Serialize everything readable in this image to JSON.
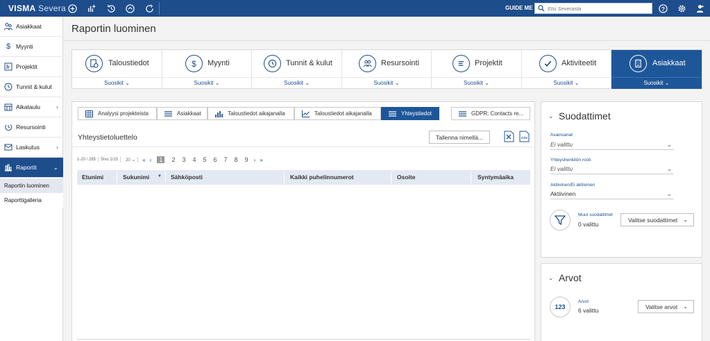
{
  "topbar": {
    "brand_bold": "VISMA",
    "brand_light": "Severa",
    "guide_label": "GUIDE ME",
    "search_placeholder": "Etsi Severasta"
  },
  "sidebar": {
    "items": [
      {
        "label": "Asiakkaat",
        "icon": "customers-icon"
      },
      {
        "label": "Myynti",
        "icon": "dollar-icon"
      },
      {
        "label": "Projektit",
        "icon": "project-icon"
      },
      {
        "label": "Tunnit & kulut",
        "icon": "clock-icon"
      },
      {
        "label": "Aikataulu",
        "icon": "calendar-icon"
      },
      {
        "label": "Resursointi",
        "icon": "resource-icon"
      },
      {
        "label": "Laskutus",
        "icon": "invoice-icon"
      },
      {
        "label": "Raportit",
        "icon": "reports-icon"
      }
    ],
    "sub_items": [
      {
        "label": "Raportin luominen"
      },
      {
        "label": "Raporttigalleria"
      }
    ]
  },
  "page": {
    "title": "Raportin luominen"
  },
  "cards": [
    {
      "label": "Taloustiedot",
      "favorites": "Suosikit"
    },
    {
      "label": "Myynti",
      "favorites": "Suosikit"
    },
    {
      "label": "Tunnit & kulut",
      "favorites": "Suosikit"
    },
    {
      "label": "Resursointi",
      "favorites": "Suosikit"
    },
    {
      "label": "Projektit",
      "favorites": "Suosikit"
    },
    {
      "label": "Aktiviteetit",
      "favorites": "Suosikit"
    },
    {
      "label": "Asiakkaat",
      "favorites": "Suosikit"
    }
  ],
  "tabs": [
    {
      "label": "Analyysi projekteista"
    },
    {
      "label": "Asiakkaat"
    },
    {
      "label": "Taloustiedot aikajanalla"
    },
    {
      "label": "Taloustiedot aikajanalla"
    },
    {
      "label": "Yhteystiedot"
    },
    {
      "label": "GDPR: Contacts re..."
    }
  ],
  "report": {
    "list_title": "Yhteystietoluettelo",
    "save_label": "Tallenna nimellä...",
    "pager": {
      "range": "1-20 / 285",
      "page_info": "Sivu 1/15",
      "page_size": "20",
      "pages": [
        "1",
        "2",
        "3",
        "4",
        "5",
        "6",
        "7",
        "8",
        "9"
      ],
      "current_page": "1"
    },
    "columns": [
      "Etunimi",
      "Sukunimi",
      "Sähköposti",
      "Kaikki puhelinnumerot",
      "Osoite",
      "Syntymäaika"
    ]
  },
  "filters": {
    "title": "Suodattimet",
    "fields": [
      {
        "label": "Avainsanat",
        "value": "Ei valittu"
      },
      {
        "label": "Yhteyshenkilön rooli",
        "value": "Ei valittu"
      },
      {
        "label": "Aktiivinen/Ei aktiivinen",
        "value": "Aktiivinen"
      }
    ],
    "other_label": "Muut suodattimet",
    "other_value": "0 valittu",
    "select_button": "Valitse suodattimet"
  },
  "values": {
    "title": "Arvot",
    "icon_text": "123",
    "label": "Arvot",
    "value": "6 valittu",
    "select_button": "Valitse arvot"
  },
  "colors": {
    "brand": "#1e4d8c",
    "active": "#1e5799"
  }
}
